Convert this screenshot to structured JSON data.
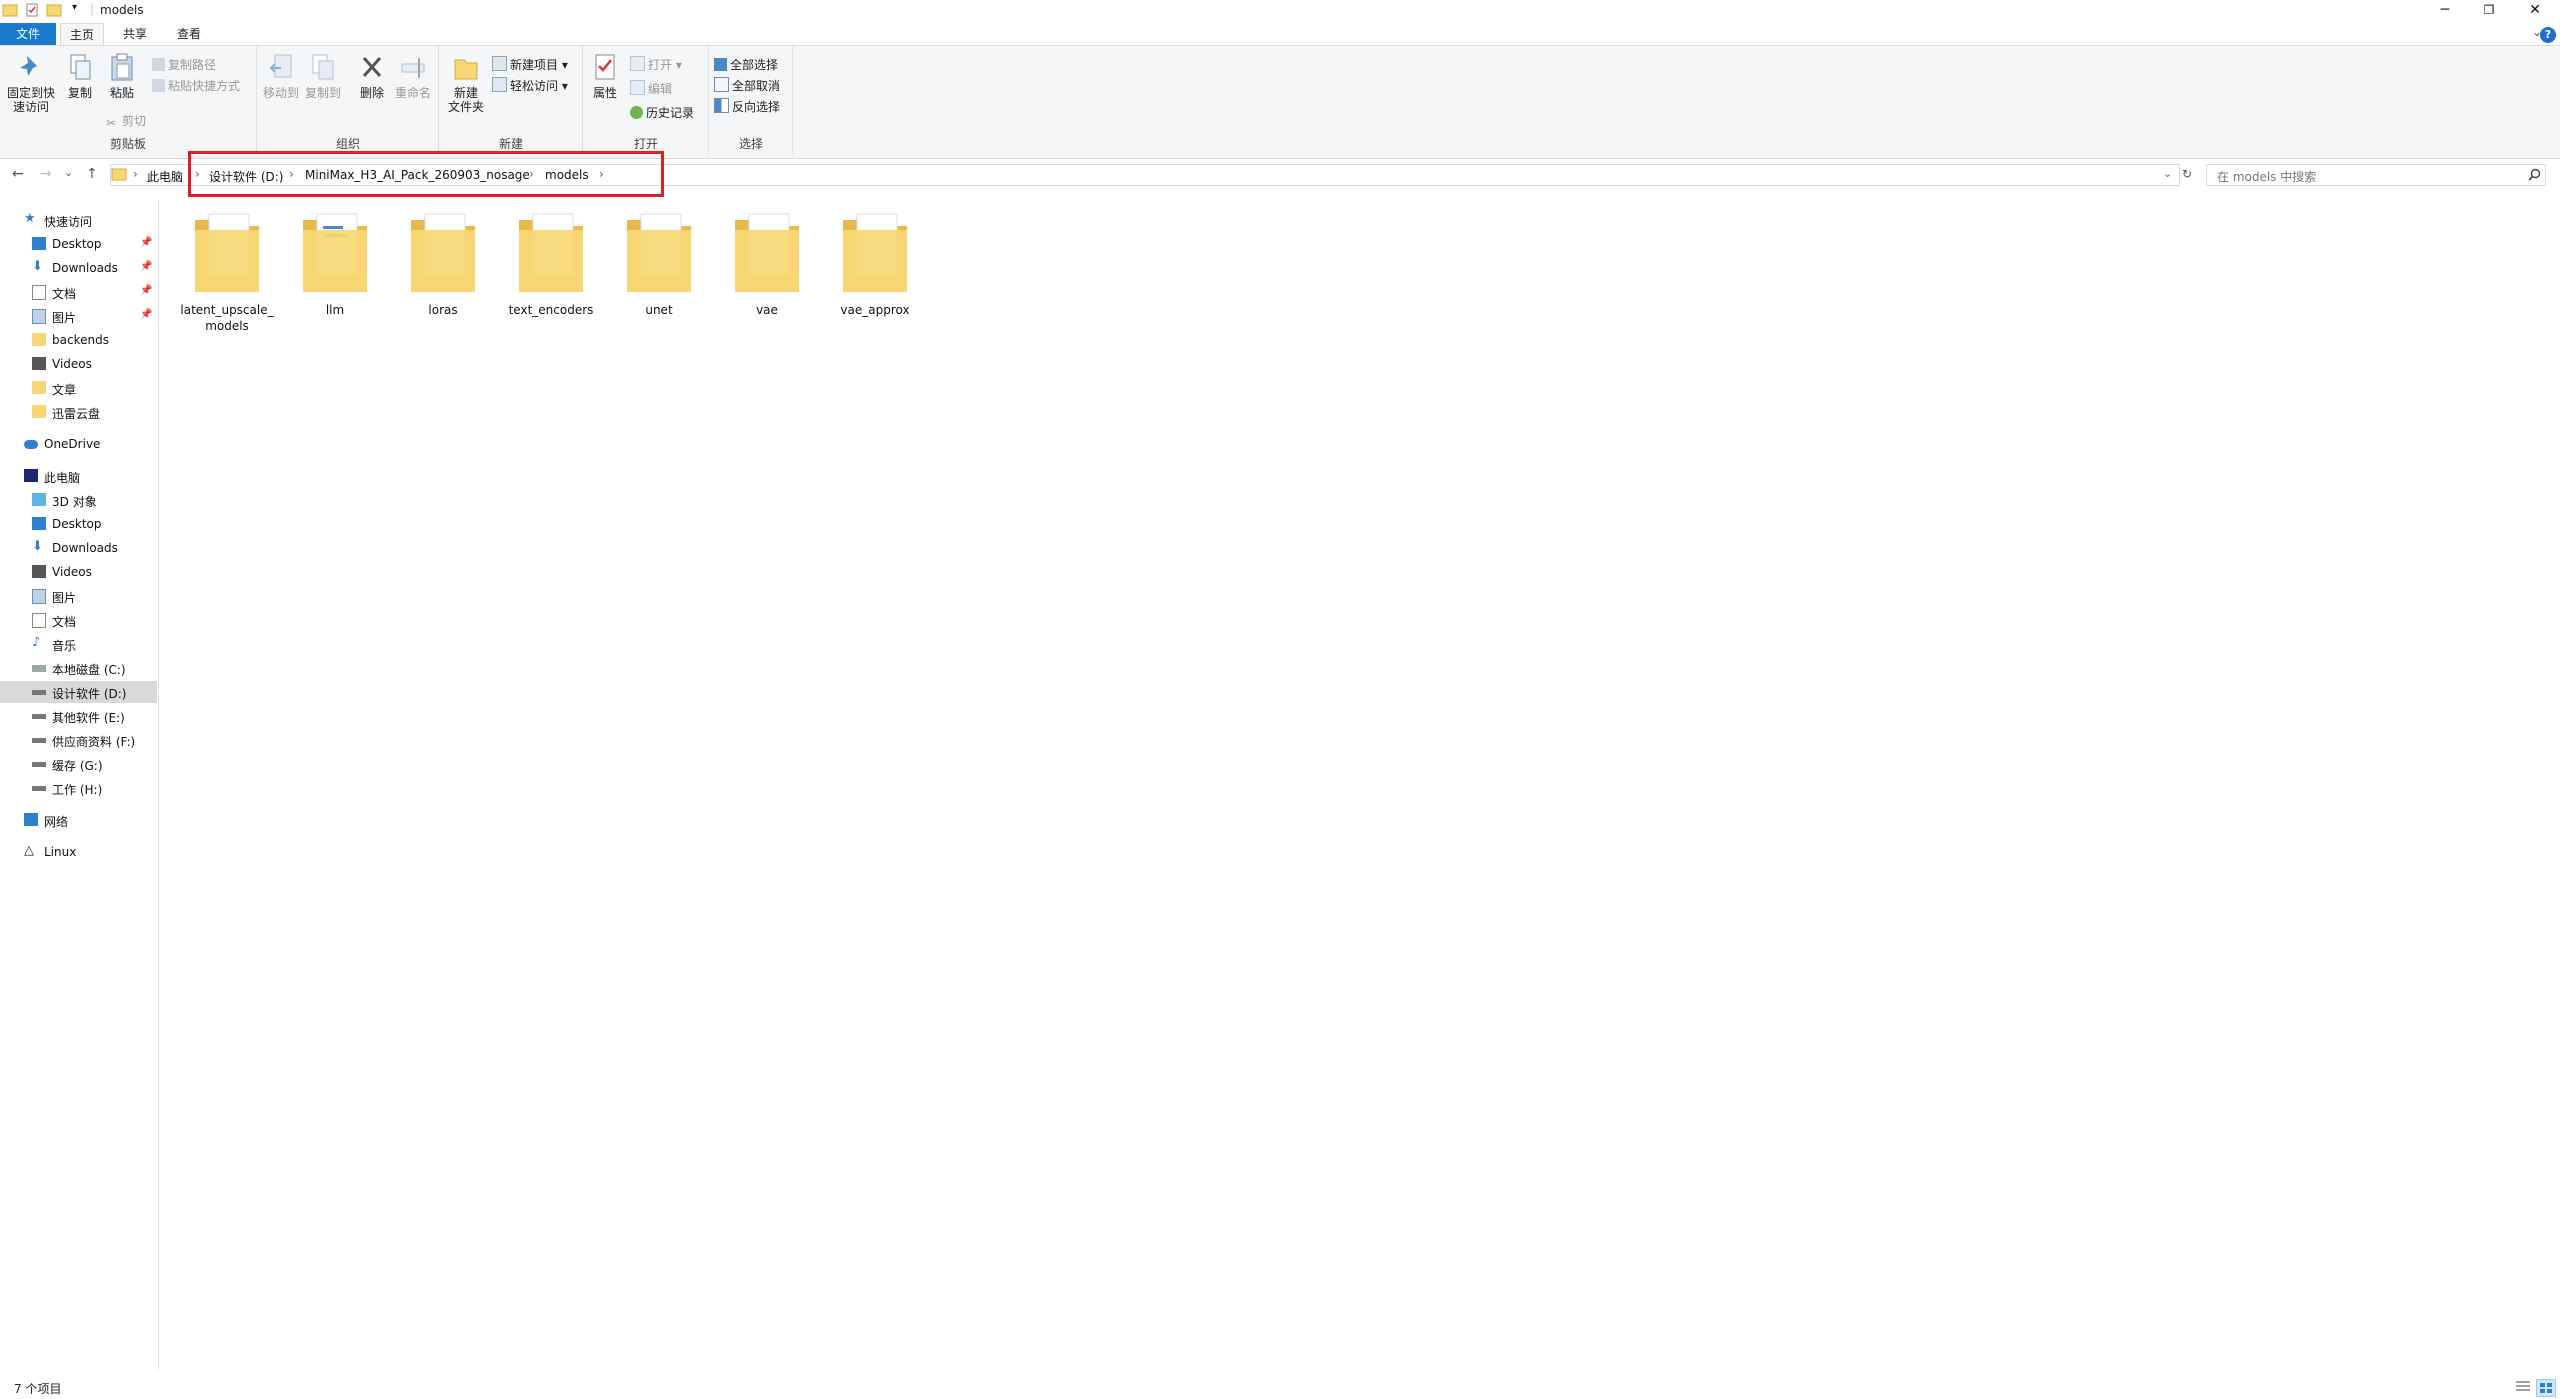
{
  "window": {
    "title": "models",
    "controls": {
      "minimize": "─",
      "maximize": "❐",
      "close": "✕"
    }
  },
  "ribbon_tabs": [
    {
      "label": "文件"
    },
    {
      "label": "主页"
    },
    {
      "label": "共享"
    },
    {
      "label": "查看"
    }
  ],
  "help_label": "?",
  "ribbon": {
    "clipboard": {
      "label": "剪贴板",
      "pin": "固定到快速访问",
      "pin_line1": "固定到快",
      "pin_line2": "速访问",
      "copy": "复制",
      "paste": "粘贴",
      "copy_path": "复制路径",
      "paste_shortcut": "粘贴快捷方式",
      "cut": "剪切"
    },
    "organize": {
      "label": "组织",
      "move_to": "移动到",
      "copy_to": "复制到",
      "delete": "删除",
      "rename": "重命名"
    },
    "new": {
      "label": "新建",
      "new_folder_line1": "新建",
      "new_folder_line2": "文件夹",
      "new_item": "新建项目",
      "easy_access": "轻松访问"
    },
    "open": {
      "label": "打开",
      "properties": "属性",
      "open": "打开",
      "edit": "编辑",
      "history": "历史记录"
    },
    "select": {
      "label": "选择",
      "select_all": "全部选择",
      "select_none": "全部取消",
      "invert": "反向选择"
    }
  },
  "nav": {
    "back": "←",
    "forward": "→",
    "recent": "⌄",
    "up": "↑",
    "refresh": "↻",
    "dropdown": "⌄"
  },
  "breadcrumb": [
    {
      "label": "此电脑"
    },
    {
      "label": "设计软件 (D:)"
    },
    {
      "label": "MiniMax_H3_AI_Pack_260903_nosage"
    },
    {
      "label": "models"
    }
  ],
  "breadcrumb_sep": "›",
  "search": {
    "placeholder": "在 models 中搜索"
  },
  "sidebar": {
    "quick_access": "快速访问",
    "quick_items": [
      {
        "label": "Desktop",
        "pinned": true
      },
      {
        "label": "Downloads",
        "pinned": true
      },
      {
        "label": "文档",
        "pinned": true
      },
      {
        "label": "图片",
        "pinned": true
      },
      {
        "label": "backends"
      },
      {
        "label": "Videos"
      },
      {
        "label": "文章"
      },
      {
        "label": "迅雷云盘"
      }
    ],
    "onedrive": "OneDrive",
    "this_pc": "此电脑",
    "pc_items": [
      {
        "label": "3D 对象"
      },
      {
        "label": "Desktop"
      },
      {
        "label": "Downloads"
      },
      {
        "label": "Videos"
      },
      {
        "label": "图片"
      },
      {
        "label": "文档"
      },
      {
        "label": "音乐"
      },
      {
        "label": "本地磁盘 (C:)"
      },
      {
        "label": "设计软件 (D:)"
      },
      {
        "label": "其他软件 (E:)"
      },
      {
        "label": "供应商资料 (F:)"
      },
      {
        "label": "缓存 (G:)"
      },
      {
        "label": "工作 (H:)"
      }
    ],
    "network": "网络",
    "linux": "Linux",
    "pin_glyph": "📌"
  },
  "folders": [
    {
      "name": "latent_upscale_models",
      "line1": "latent_upscale_",
      "line2": "models"
    },
    {
      "name": "llm",
      "line1": "llm"
    },
    {
      "name": "loras",
      "line1": "loras"
    },
    {
      "name": "text_encoders",
      "line1": "text_encoders"
    },
    {
      "name": "unet",
      "line1": "unet"
    },
    {
      "name": "vae",
      "line1": "vae"
    },
    {
      "name": "vae_approx",
      "line1": "vae_approx"
    }
  ],
  "status": {
    "item_count": "7 个项目"
  },
  "colors": {
    "accent": "#1979ca",
    "folder": "#f7d774",
    "highlight_box": "#e02020",
    "selected_bg": "#d9d9d9"
  }
}
